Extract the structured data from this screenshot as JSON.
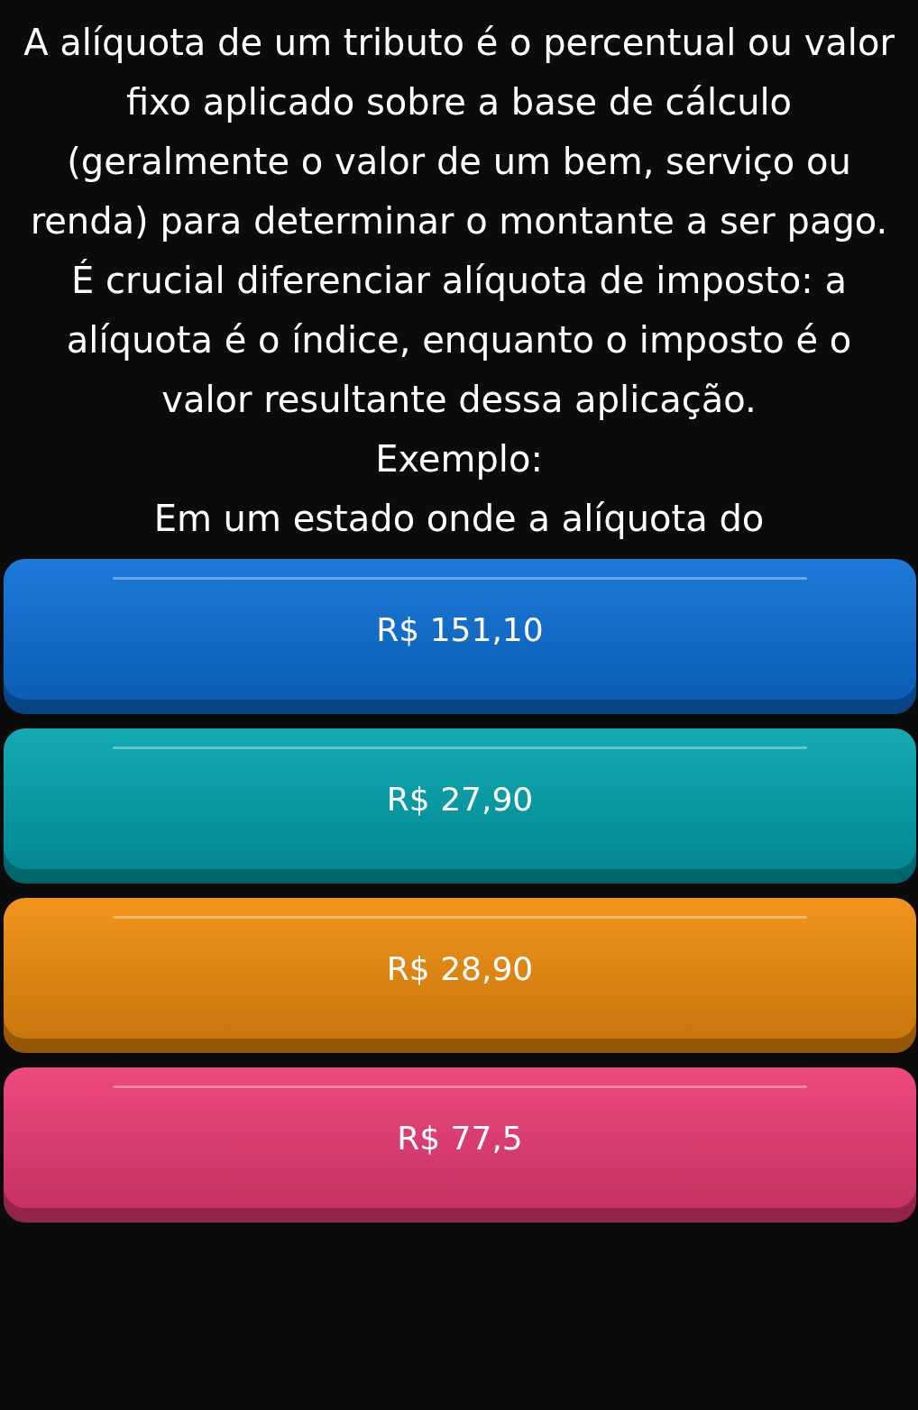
{
  "question": {
    "text": "A alíquota de um tributo é o percentual ou valor fixo aplicado sobre a base de cálculo (geralmente o valor de um bem, serviço ou renda) para determinar o montante a ser pago. É crucial diferenciar alíquota de imposto: a alíquota é o índice, enquanto o imposto é o valor resultante dessa aplicação.",
    "example_label": "Exemplo:",
    "example_text": "Em um estado onde a alíquota do"
  },
  "answers": [
    {
      "label": "R$ 151,10",
      "color": "#0a6fd6"
    },
    {
      "label": "R$ 27,90",
      "color": "#00a3ad"
    },
    {
      "label": "R$ 28,90",
      "color": "#f08c0a"
    },
    {
      "label": "R$ 77,5",
      "color": "#ec3a73"
    }
  ]
}
